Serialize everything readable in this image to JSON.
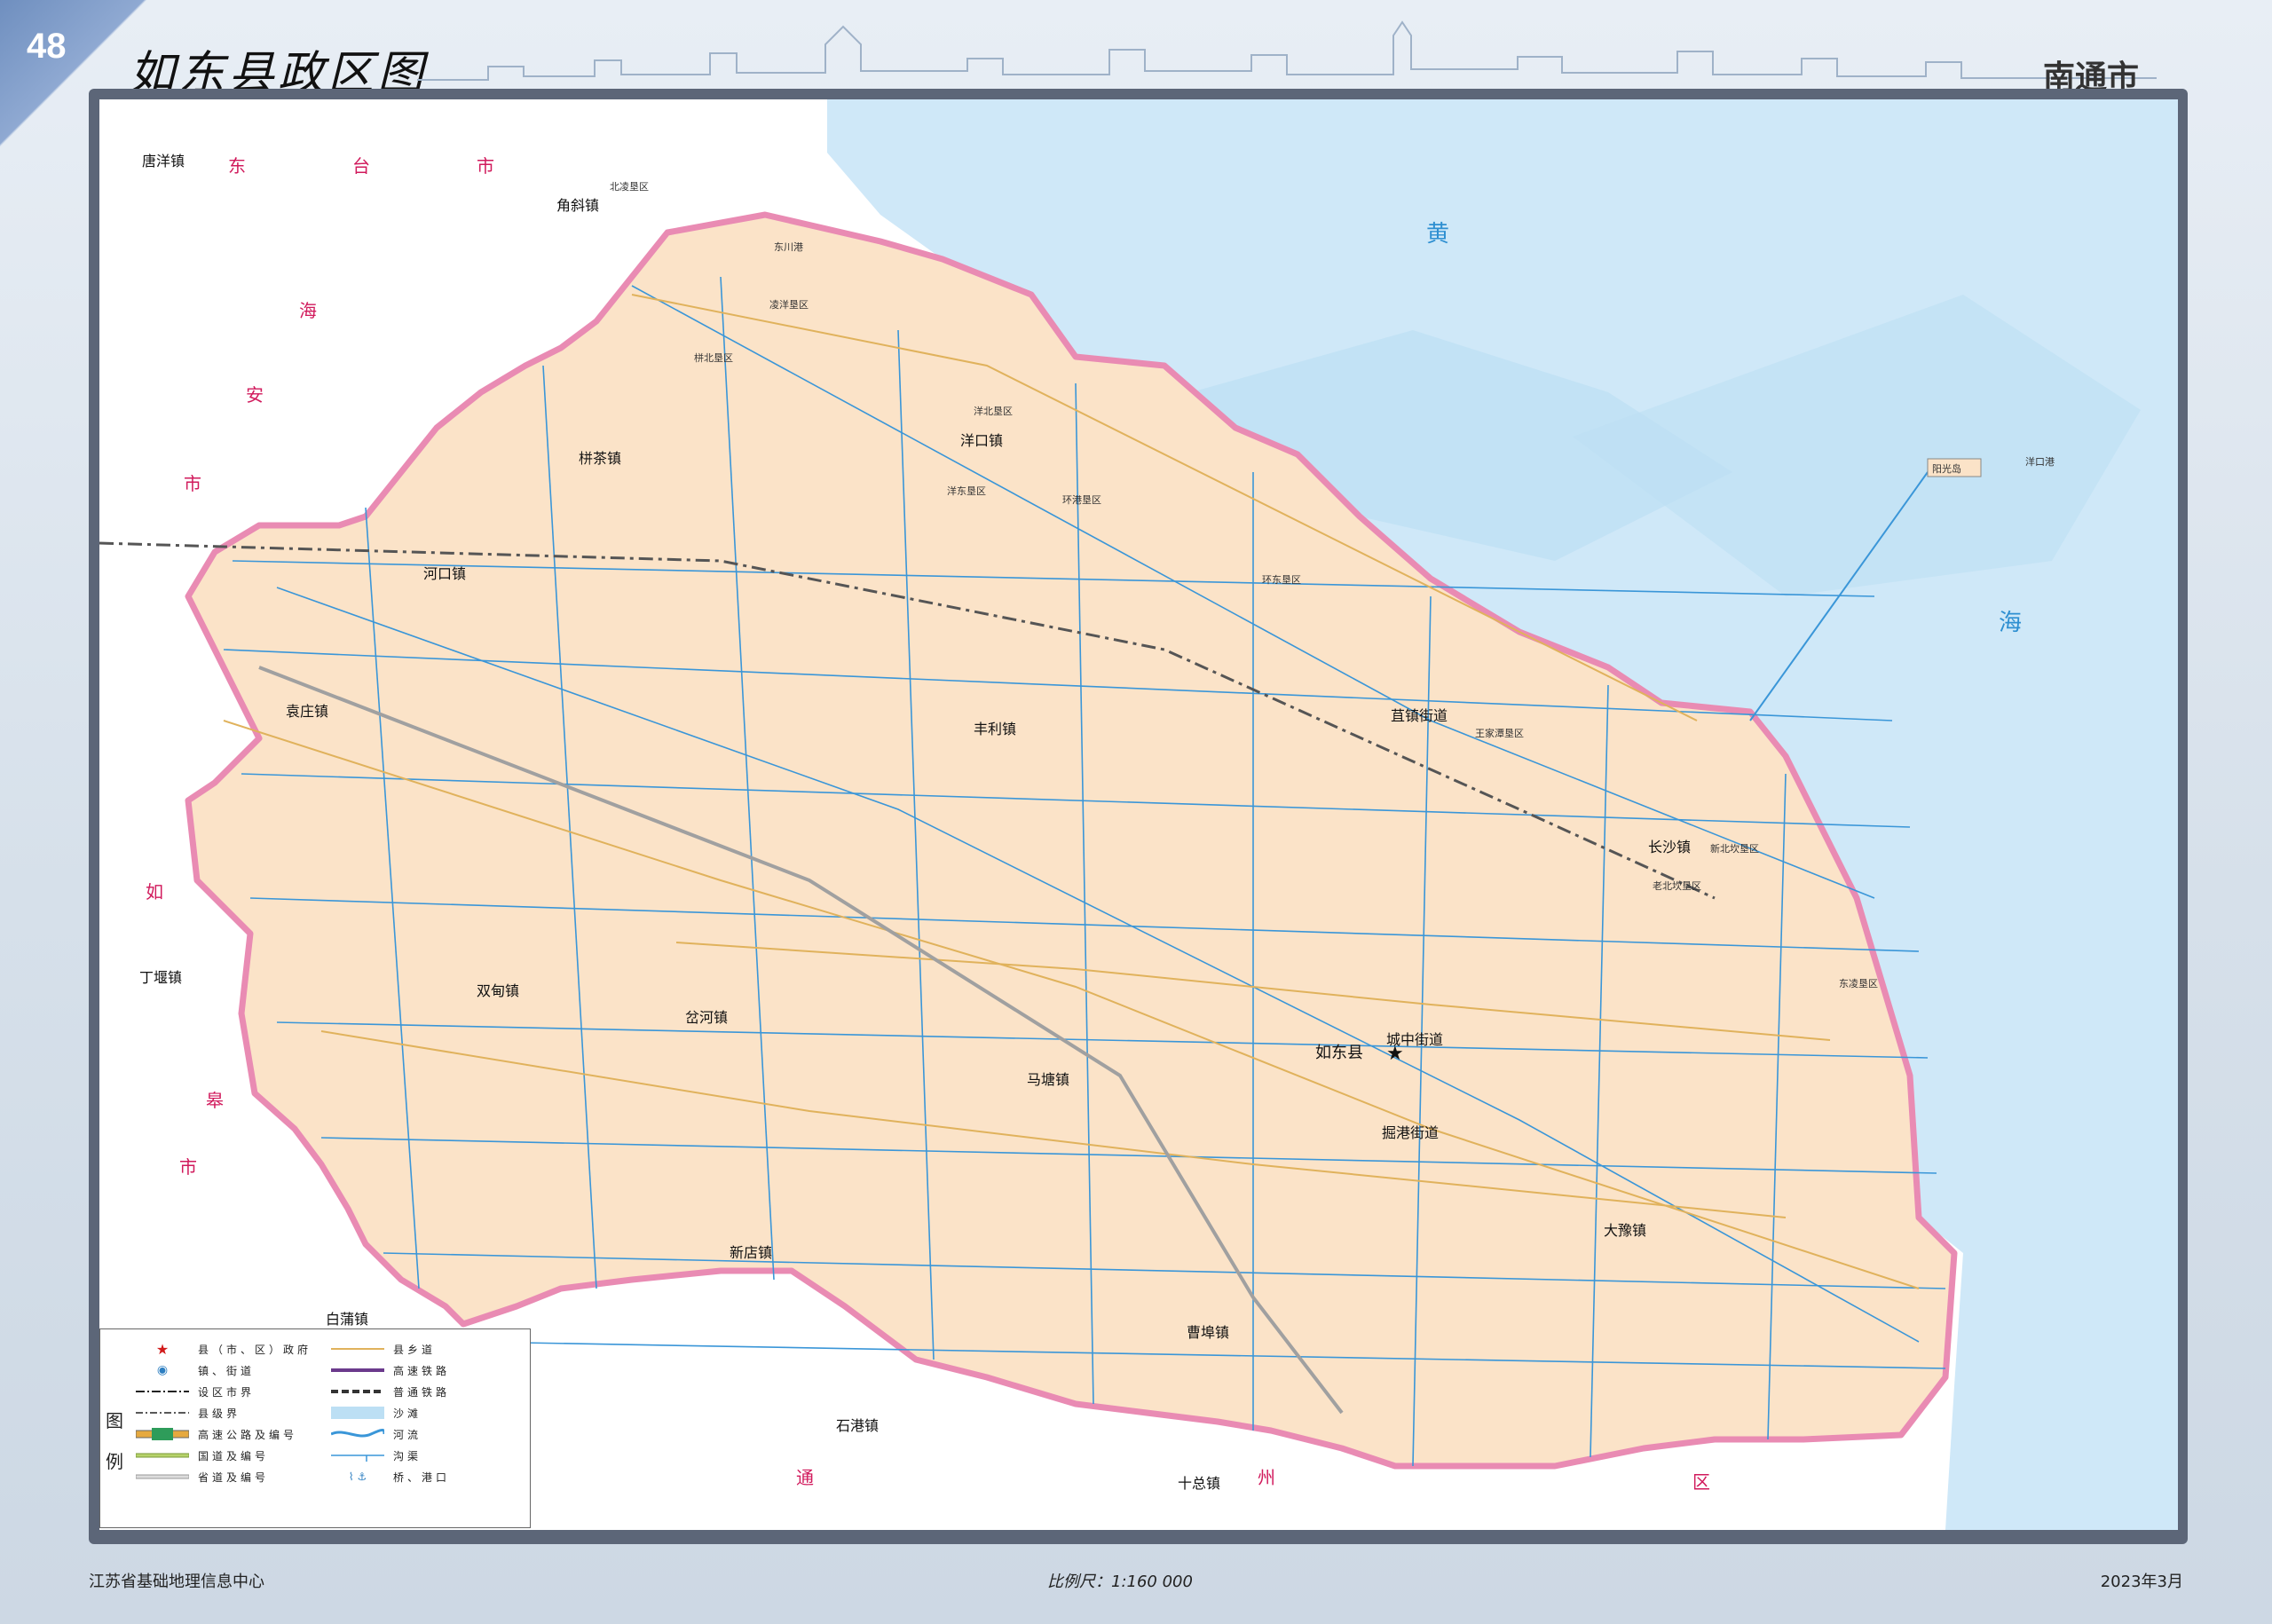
{
  "page_number": "48",
  "title": "如东县政区图",
  "city": "南通市",
  "footer": {
    "publisher": "江苏省基础地理信息中心",
    "scale": "比例尺：1:160 000",
    "date": "2023年3月"
  },
  "colors": {
    "land": "#fbe3c8",
    "sea": "#cfe8f8",
    "river": "#3a96d8",
    "boundary": "#e98bb3",
    "road": "#e0b25c"
  },
  "places": {
    "county_seat": "如东县",
    "towns": [
      "唐洋镇",
      "角斜镇",
      "栟茶镇",
      "洋口镇",
      "河口镇",
      "袁庄镇",
      "丰利镇",
      "苴镇街道",
      "长沙镇",
      "丁堰镇",
      "双甸镇",
      "岔河镇",
      "城中街道",
      "马塘镇",
      "掘港街道",
      "大豫镇",
      "新店镇",
      "白蒲镇",
      "曹埠镇",
      "石港镇",
      "十总镇"
    ],
    "areas": [
      "北凌垦区",
      "东川港",
      "凌洋垦区",
      "栟北垦区",
      "洋北垦区",
      "洋东垦区",
      "环港垦区",
      "环东垦区",
      "王家潭垦区",
      "新北坎垦区",
      "老北坎垦区",
      "东凌垦区",
      "阳光岛",
      "洋口港"
    ],
    "neighbors": [
      "东",
      "台",
      "市",
      "海",
      "安",
      "市",
      "如",
      "皋",
      "市",
      "通",
      "州",
      "区"
    ],
    "water": [
      "黄",
      "海"
    ]
  },
  "legend": {
    "heading": "图例",
    "left": [
      "县（市、区）政府",
      "镇、街道",
      "设区市界",
      "县级界",
      "高速公路及编号",
      "国道及编号",
      "省道及编号"
    ],
    "right": [
      "县乡道",
      "高速铁路",
      "普通铁路",
      "沙滩",
      "河流",
      "沟渠",
      "桥、港口"
    ]
  }
}
